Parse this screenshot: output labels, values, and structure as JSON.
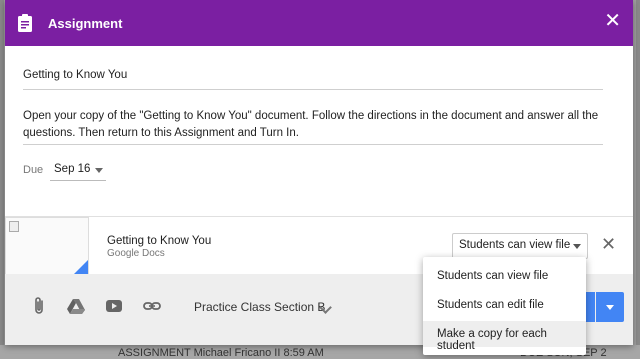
{
  "dialog": {
    "title": "Assignment",
    "close_icon": "close-icon",
    "title_value": "Getting to Know You",
    "description": "Open your copy of the \"Getting to Know You\" document. Follow the directions in the document and answer all the questions. Then return to this Assignment and Turn In.",
    "due_label": "Due",
    "due_value": "Sep 16",
    "header_color": "#7b1fa2"
  },
  "attachment": {
    "title": "Getting to Know You",
    "subtitle": "Google Docs",
    "permission_value": "Students can view file"
  },
  "footer": {
    "icons": [
      "paperclip-icon",
      "drive-icon",
      "youtube-icon",
      "link-icon"
    ],
    "class_value": "Practice Class Section B",
    "accent_color": "#4285f4"
  },
  "permission_menu": {
    "options": [
      "Students can view file",
      "Students can edit file",
      "Make a copy for each student"
    ],
    "highlighted_index": 2
  },
  "background": {
    "row_text": "ASSIGNMENT  Michael Fricano II 8:59 AM",
    "right_text": "DUE SUN, SEP 2"
  }
}
